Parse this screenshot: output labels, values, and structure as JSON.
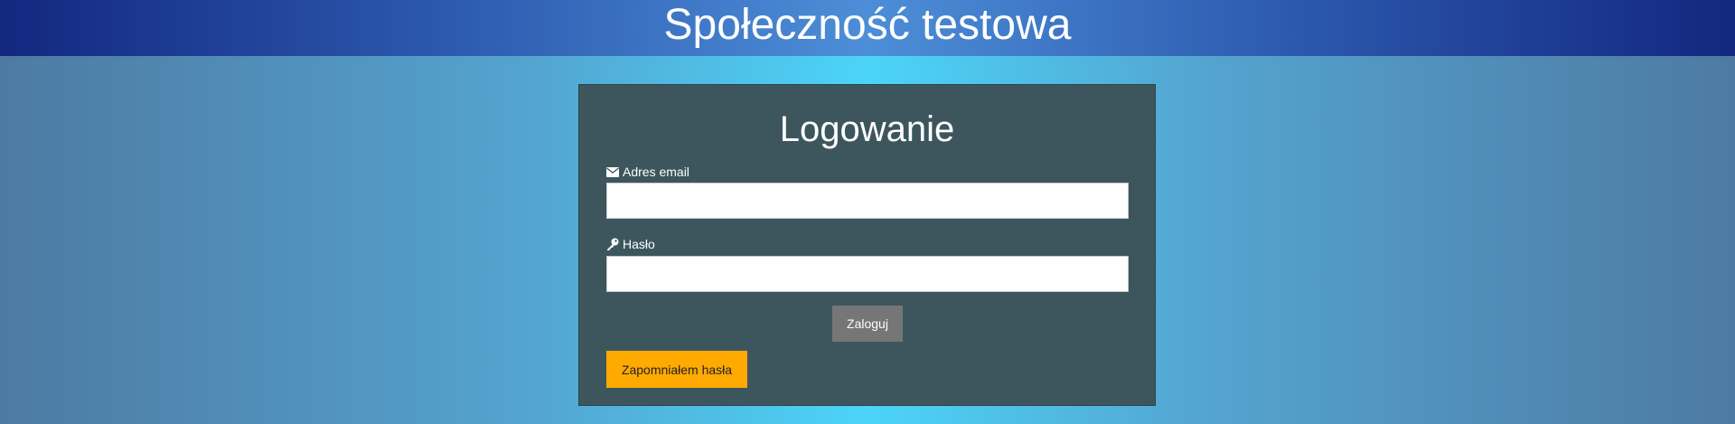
{
  "header": {
    "title": "Społeczność testowa"
  },
  "login": {
    "title": "Logowanie",
    "email_label": "Adres email",
    "email_icon": "envelope-icon",
    "email_value": "",
    "password_label": "Hasło",
    "password_icon": "key-icon",
    "password_value": "",
    "submit_label": "Zaloguj",
    "forgot_label": "Zapomniałem hasła"
  },
  "colors": {
    "panel_background": "#3d565e",
    "submit_button": "#767676",
    "forgot_button": "#ffaa00",
    "header_dark": "#13277f",
    "header_light": "#4d8ed8"
  }
}
